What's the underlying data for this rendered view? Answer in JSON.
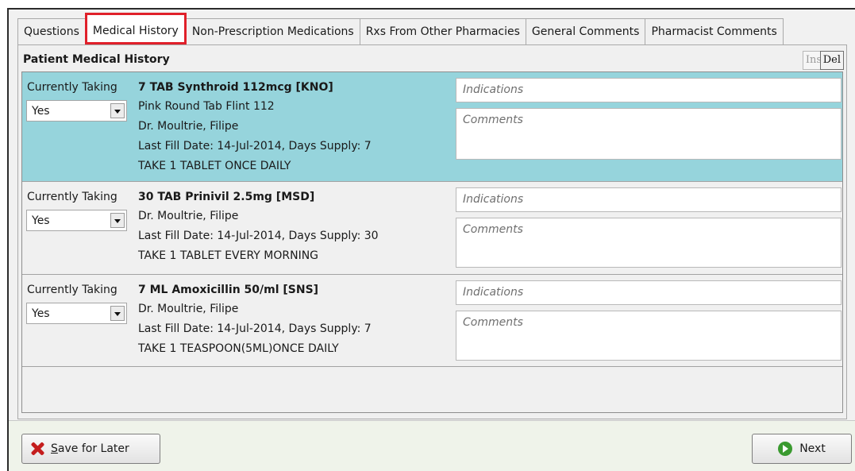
{
  "tabs": [
    {
      "label": "Questions"
    },
    {
      "label": "Medical History"
    },
    {
      "label": "Non-Prescription Medications"
    },
    {
      "label": "Rxs From Other Pharmacies"
    },
    {
      "label": "General Comments"
    },
    {
      "label": "Pharmacist Comments"
    }
  ],
  "active_tab": "Medical History",
  "panel": {
    "title": "Patient Medical History",
    "ins_label": "Ins",
    "del_label": "Del"
  },
  "rows": [
    {
      "selected": true,
      "currently_taking_label": "Currently Taking",
      "currently_taking_value": "Yes",
      "drug": "7 TAB Synthroid 112mcg [KNO]",
      "lines": [
        "Pink Round Tab Flint 112",
        "Dr. Moultrie, Filipe",
        "Last Fill Date: 14-Jul-2014, Days Supply: 7",
        "TAKE 1 TABLET ONCE DAILY"
      ],
      "indications_placeholder": "Indications",
      "comments_placeholder": "Comments"
    },
    {
      "selected": false,
      "currently_taking_label": "Currently Taking",
      "currently_taking_value": "Yes",
      "drug": "30 TAB Prinivil 2.5mg [MSD]",
      "lines": [
        "Dr. Moultrie, Filipe",
        "Last Fill Date: 14-Jul-2014, Days Supply: 30",
        "TAKE 1 TABLET EVERY MORNING"
      ],
      "indications_placeholder": "Indications",
      "comments_placeholder": "Comments"
    },
    {
      "selected": false,
      "currently_taking_label": "Currently Taking",
      "currently_taking_value": "Yes",
      "drug": "7 ML Amoxicillin 50/ml [SNS]",
      "lines": [
        "Dr. Moultrie, Filipe",
        "Last Fill Date: 14-Jul-2014, Days Supply: 7",
        "TAKE 1 TEASPOON(5ML)ONCE DAILY"
      ],
      "indications_placeholder": "Indications",
      "comments_placeholder": "Comments"
    }
  ],
  "footer": {
    "save_label_first": "S",
    "save_label_rest": "ave for Later",
    "next_label": "Next"
  },
  "colors": {
    "selected_row": "#96d4dc",
    "active_tab_outline": "#e0202a",
    "save_icon": "#c41d1d",
    "next_icon": "#3a9a2f"
  },
  "icons": {
    "save": "x-icon",
    "next": "arrow-right-circle-icon",
    "dropdown": "chevron-down-icon"
  }
}
